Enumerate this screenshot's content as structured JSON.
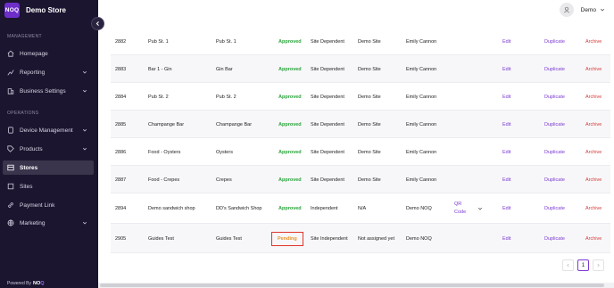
{
  "brand": {
    "logo_text": "NOQ",
    "name": "Demo Store"
  },
  "sidebar": {
    "section_management": "MANAGEMENT",
    "section_operations": "OPERATIONS",
    "items": [
      {
        "label": "Homepage",
        "icon": "home-icon",
        "has_chevron": false
      },
      {
        "label": "Reporting",
        "icon": "chart-icon",
        "has_chevron": true
      },
      {
        "label": "Business Settings",
        "icon": "building-icon",
        "has_chevron": true
      },
      {
        "label": "Device Management",
        "icon": "device-icon",
        "has_chevron": true
      },
      {
        "label": "Products",
        "icon": "tag-icon",
        "has_chevron": true
      },
      {
        "label": "Stores",
        "icon": "store-icon",
        "has_chevron": false,
        "active": true
      },
      {
        "label": "Sites",
        "icon": "sites-icon",
        "has_chevron": false
      },
      {
        "label": "Payment Link",
        "icon": "link-icon",
        "has_chevron": false
      },
      {
        "label": "Marketing",
        "icon": "globe-icon",
        "has_chevron": true
      }
    ],
    "powered_by": "Powered By",
    "powered_logo_a": "NO",
    "powered_logo_b": "Q"
  },
  "header": {
    "user_name": "Demo"
  },
  "table": {
    "rows": [
      {
        "id": "2882",
        "name": "Pub St. 1",
        "display": "Pub St. 1",
        "status": "Approved",
        "type": "Site Dependent",
        "site": "Demo Site",
        "user": "Emily Cannon",
        "extra": "",
        "edit": "Edit",
        "duplicate": "Duplicate",
        "archive": "Archive"
      },
      {
        "id": "2883",
        "name": "Bar 1 - Gin",
        "display": "Gin Bar",
        "status": "Approved",
        "type": "Site Dependent",
        "site": "Demo Site",
        "user": "Emily Cannon",
        "extra": "",
        "edit": "Edit",
        "duplicate": "Duplicate",
        "archive": "Archive"
      },
      {
        "id": "2884",
        "name": "Pub St. 2",
        "display": "Pub St. 2",
        "status": "Approved",
        "type": "Site Dependent",
        "site": "Demo Site",
        "user": "Emily Cannon",
        "extra": "",
        "edit": "Edit",
        "duplicate": "Duplicate",
        "archive": "Archive"
      },
      {
        "id": "2885",
        "name": "Champange Bar",
        "display": "Champange Bar",
        "status": "Approved",
        "type": "Site Dependent",
        "site": "Demo Site",
        "user": "Emily Cannon",
        "extra": "",
        "edit": "Edit",
        "duplicate": "Duplicate",
        "archive": "Archive"
      },
      {
        "id": "2886",
        "name": "Food - Oysters",
        "display": "Oysters",
        "status": "Approved",
        "type": "Site Dependent",
        "site": "Demo Site",
        "user": "Emily Cannon",
        "extra": "",
        "edit": "Edit",
        "duplicate": "Duplicate",
        "archive": "Archive"
      },
      {
        "id": "2887",
        "name": "Food - Crepes",
        "display": "Crepes",
        "status": "Approved",
        "type": "Site Dependent",
        "site": "Demo Site",
        "user": "Emily Cannon",
        "extra": "",
        "edit": "Edit",
        "duplicate": "Duplicate",
        "archive": "Archive"
      },
      {
        "id": "2894",
        "name": "Demo sandwich shop",
        "display": "DD's Sandwich Shop",
        "status": "Approved",
        "type": "Independent",
        "site": "N/A",
        "user": "Demo NOQ",
        "extra_line1": "QR",
        "extra_line2": "Code",
        "edit": "Edit",
        "duplicate": "Duplicate",
        "archive": "Archive"
      },
      {
        "id": "2905",
        "name": "Guides Test",
        "display": "Guides Test",
        "status": "Pending",
        "type": "Site Independent",
        "site": "Not assigned yet",
        "user": "Demo NOQ",
        "extra": "",
        "edit": "Edit",
        "duplicate": "Duplicate",
        "archive": "Archive"
      }
    ]
  },
  "pagination": {
    "current_page": "1"
  },
  "colors": {
    "sidebar_bg": "#1b1530",
    "accent": "#7b3ad2",
    "approved": "#2aa43b",
    "pending": "#e7962b",
    "archive": "#d43b3b",
    "highlight_box": "#e0352b"
  }
}
